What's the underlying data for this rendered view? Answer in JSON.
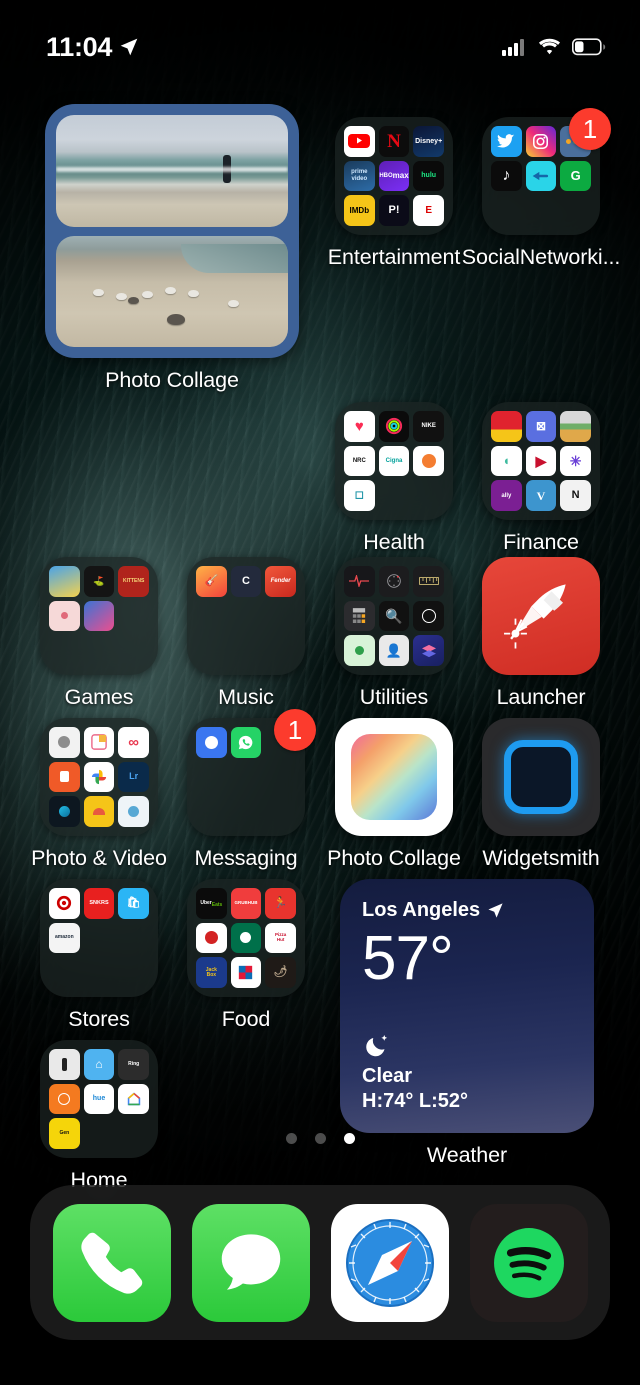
{
  "status_bar": {
    "time": "11:04",
    "location_icon": "location-arrow-icon",
    "cellular_icon": "cellular-signal-icon",
    "wifi_icon": "wifi-icon",
    "battery_icon": "battery-low-icon"
  },
  "home_screen": {
    "rows": [
      {
        "items": [
          {
            "type": "widget",
            "name": "photo-collage-widget",
            "label": "Photo Collage",
            "photos": [
              "beach-person-ocean",
              "beach-seagulls"
            ]
          },
          {
            "type": "folder",
            "name": "folder-entertainment",
            "label": "Entertainment",
            "badge": "",
            "apps": [
              "YouTube",
              "Netflix",
              "Disney+",
              "Prime Video",
              "HBO Max",
              "hulu",
              "IMDb",
              "Pluto TV",
              "ESPN"
            ]
          },
          {
            "type": "folder",
            "name": "folder-socialnetworking",
            "label": "SocialNetworki...",
            "badge": "1",
            "apps": [
              "Twitter",
              "Instagram",
              "Messenger",
              "TikTok",
              "Untappd",
              "Glassdoor"
            ]
          }
        ]
      },
      {
        "items": [
          {
            "type": "folder",
            "name": "folder-health",
            "label": "Health",
            "badge": "",
            "apps": [
              "Health",
              "Fitness",
              "Nike",
              "Nike Run Club",
              "Cigna",
              "Headspace",
              "Calm"
            ]
          },
          {
            "type": "folder",
            "name": "folder-finance",
            "label": "Finance",
            "badge": "",
            "apps": [
              "Wells Fargo",
              "Chase",
              "Wallet",
              "Mint",
              "Vanguard",
              "Splitwise",
              "Ally",
              "Venmo",
              "Nerdwallet"
            ]
          }
        ]
      },
      {
        "items": [
          {
            "type": "folder",
            "name": "folder-games",
            "label": "Games",
            "badge": "",
            "apps": [
              "Mario Kart",
              "Golf",
              "Exploding Kittens",
              "Two Dots",
              "Dance Tiles"
            ]
          },
          {
            "type": "folder",
            "name": "folder-music",
            "label": "Music",
            "badge": "",
            "apps": [
              "Ultimate Guitar",
              "Chordify",
              "Fender"
            ]
          },
          {
            "type": "folder",
            "name": "folder-utilities",
            "label": "Utilities",
            "badge": "",
            "apps": [
              "Voice Memos",
              "Compass",
              "Measure",
              "Calculator",
              "Magnifier",
              "Clock",
              "Find My",
              "Contacts",
              "Shortcuts"
            ]
          },
          {
            "type": "app",
            "name": "app-launcher",
            "label": "Launcher",
            "badge": "",
            "icon": "rocket-firework-icon"
          }
        ]
      },
      {
        "items": [
          {
            "type": "folder",
            "name": "folder-photo-video",
            "label": "Photo & Video",
            "badge": "",
            "apps": [
              "Camera",
              "Collage",
              "Infinite",
              "Unfold",
              "Google Photos",
              "Lightroom",
              "Darkroom",
              "VSCO",
              "Halide"
            ]
          },
          {
            "type": "folder",
            "name": "folder-messaging",
            "label": "Messaging",
            "badge": "1",
            "apps": [
              "Signal",
              "WhatsApp"
            ]
          },
          {
            "type": "app",
            "name": "app-photo-collage",
            "label": "Photo Collage",
            "badge": "",
            "icon": "rainbow-gradient-square-icon"
          },
          {
            "type": "app",
            "name": "app-widgetsmith",
            "label": "Widgetsmith",
            "badge": "",
            "icon": "blue-rounded-square-icon"
          }
        ]
      },
      {
        "items": [
          {
            "type": "folder",
            "name": "folder-stores",
            "label": "Stores",
            "badge": "",
            "apps": [
              "Target",
              "SNKRS",
              "Shop",
              "Amazon"
            ]
          },
          {
            "type": "folder",
            "name": "folder-food",
            "label": "Food",
            "badge": "",
            "apps": [
              "Uber Eats",
              "Grubhub",
              "Postmates",
              "Yelp",
              "Starbucks",
              "Pizza Hut",
              "Jack in the Box",
              "Domino's",
              "Chipotle"
            ]
          },
          {
            "type": "widget",
            "name": "weather-widget",
            "label": "Weather",
            "city": "Los Angeles",
            "temperature": "57°",
            "condition": "Clear",
            "high_low": "H:74° L:52°",
            "condition_icon": "moon-stars-icon",
            "location_icon": "location-arrow-icon"
          }
        ]
      },
      {
        "items": [
          {
            "type": "folder",
            "name": "folder-home",
            "label": "Home",
            "badge": "",
            "apps": [
              "Home",
              "Nest",
              "Ring",
              "Thermostat",
              "Hue",
              "Google Home",
              "Garage"
            ]
          }
        ]
      }
    ]
  },
  "page_indicator": {
    "total": 3,
    "active_index": 3
  },
  "dock": {
    "apps": [
      {
        "name": "dock-app-phone",
        "label": "Phone",
        "icon": "phone-icon"
      },
      {
        "name": "dock-app-messages",
        "label": "Messages",
        "icon": "message-bubble-icon"
      },
      {
        "name": "dock-app-safari",
        "label": "Safari",
        "icon": "compass-icon"
      },
      {
        "name": "dock-app-spotify",
        "label": "Spotify",
        "icon": "spotify-icon"
      }
    ]
  },
  "colors": {
    "badge_red": "#fc3b2d",
    "launcher_red": "#de3b30",
    "widget_blue": "#3d6197",
    "dock_bg": "rgba(40,40,40,0.66)",
    "folder_bg": "rgba(28,36,34,0.72)",
    "weather_gradient_start": "#141c3f",
    "weather_gradient_end": "#4a4f76"
  }
}
